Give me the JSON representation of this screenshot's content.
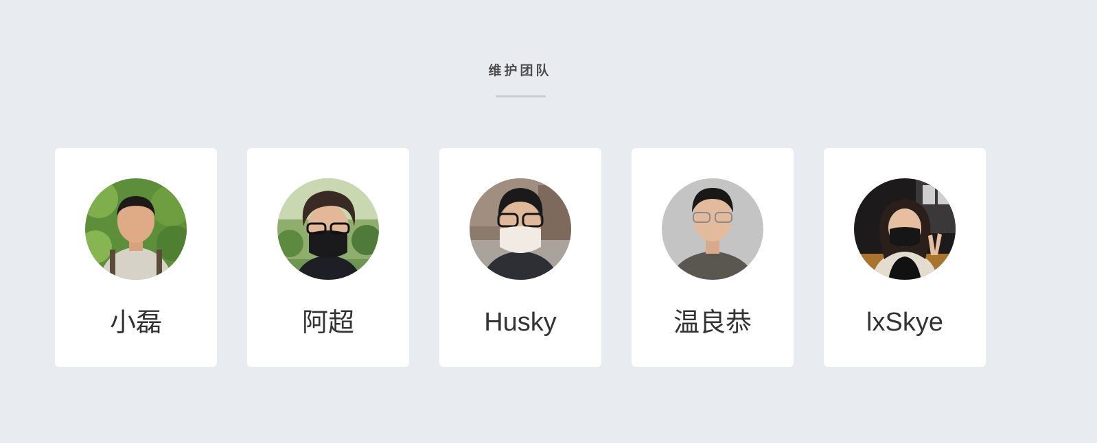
{
  "section": {
    "title": "维护团队"
  },
  "team": [
    {
      "name": "小磊",
      "avatar_icon": "person-photo-icon"
    },
    {
      "name": "阿超",
      "avatar_icon": "person-photo-icon"
    },
    {
      "name": "Husky",
      "avatar_icon": "person-photo-icon"
    },
    {
      "name": "温良恭",
      "avatar_icon": "person-photo-icon"
    },
    {
      "name": "lxSkye",
      "avatar_icon": "person-photo-icon"
    }
  ],
  "colors": {
    "background": "#e8ebf0",
    "card": "#ffffff",
    "title": "#4d4d4d",
    "name": "#333333",
    "rule": "#c9cdd4"
  }
}
